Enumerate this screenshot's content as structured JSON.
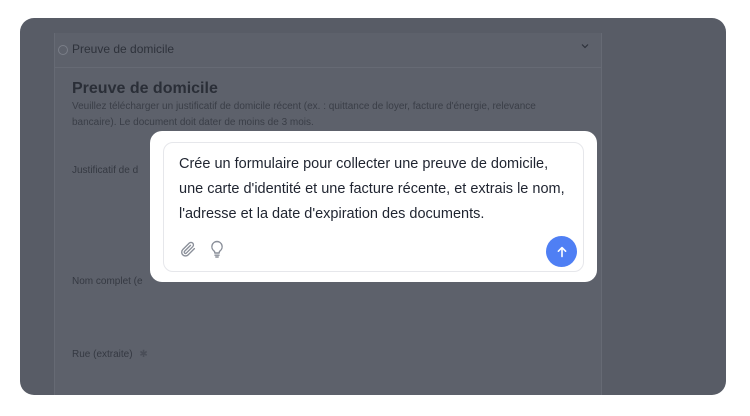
{
  "background_form": {
    "section_title": "Preuve de domicile",
    "heading": "Preuve de domicile",
    "description": "Veuillez télécharger un justificatif de domicile récent (ex. : quittance de loyer, facture d'énergie, relevance bancaire). Le document doit dater de moins de 3 mois.",
    "fields": [
      {
        "label": "Justificatif de d"
      },
      {
        "label": "Nom complet (e"
      },
      {
        "label": "Rue (extraite)"
      }
    ]
  },
  "prompt": {
    "text": "Crée un formulaire pour collecter une preuve de domicile, une carte d'identité et une facture récente, et extrais le nom, l'adresse et la date d'expiration des documents.",
    "icons": [
      "paperclip-icon",
      "lightbulb-icon",
      "arrow-up-icon"
    ]
  },
  "colors": {
    "overlay": "#585c66",
    "accent": "#4f7ff4"
  }
}
